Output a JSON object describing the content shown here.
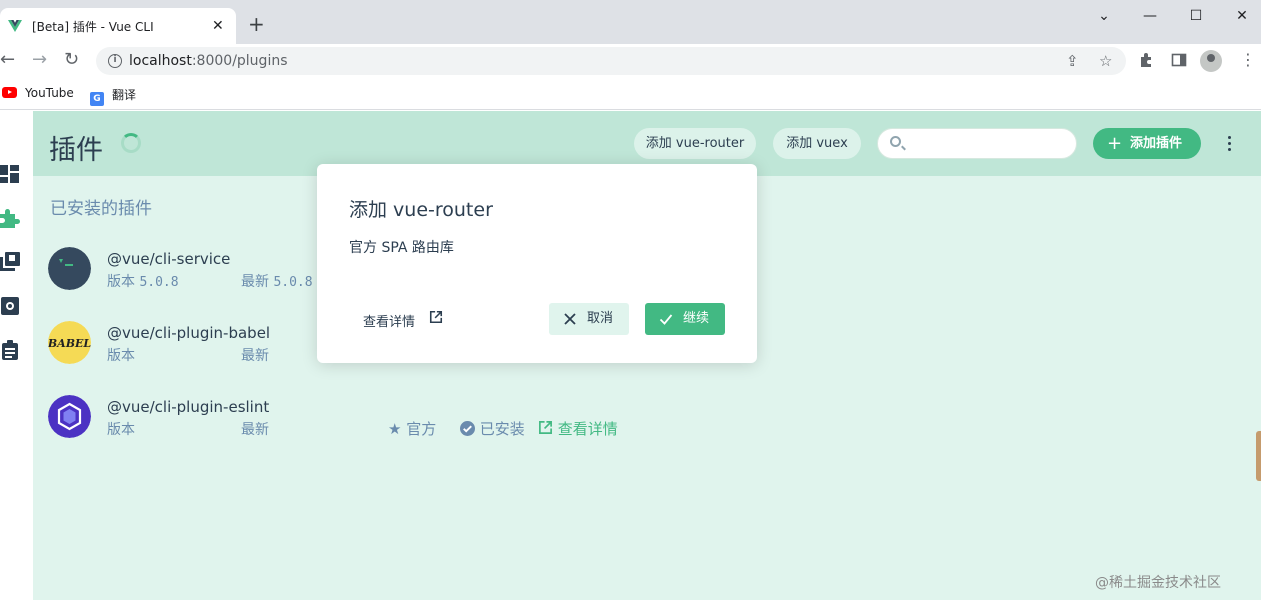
{
  "browser": {
    "tab_title": "[Beta] 插件 - Vue CLI",
    "url_host": "localhost",
    "url_path": ":8000/plugins",
    "bookmarks": [
      {
        "label": "YouTube",
        "icon": "youtube-icon"
      },
      {
        "label": "翻译",
        "icon": "google-translate-icon"
      }
    ]
  },
  "header": {
    "title": "插件",
    "quick_actions": [
      {
        "label": "添加 vue-router"
      },
      {
        "label": "添加 vuex"
      }
    ],
    "search_placeholder": "",
    "add_button": "添加插件"
  },
  "sidebar": {
    "items": [
      {
        "name": "dashboard",
        "icon": "dashboard-icon"
      },
      {
        "name": "plugins",
        "icon": "puzzle-icon",
        "active": true
      },
      {
        "name": "dependencies",
        "icon": "library-icon"
      },
      {
        "name": "configuration",
        "icon": "settings-icon"
      },
      {
        "name": "tasks",
        "icon": "clipboard-icon"
      }
    ]
  },
  "main": {
    "section_title": "已安装的插件",
    "plugins": [
      {
        "name": "@vue/cli-service",
        "version_label": "版本",
        "version": "5.0.8",
        "latest_label": "最新",
        "latest": "5.0.8"
      },
      {
        "name": "@vue/cli-plugin-babel",
        "version_label": "版本",
        "latest_label": "最新"
      },
      {
        "name": "@vue/cli-plugin-eslint",
        "version_label": "版本",
        "latest_label": "最新",
        "official": "官方",
        "installed": "已安装",
        "details": "查看详情"
      }
    ]
  },
  "modal": {
    "title": "添加 vue-router",
    "description": "官方 SPA 路由库",
    "more_info": "查看详情",
    "cancel": "取消",
    "continue": "继续"
  },
  "watermark": "@稀土掘金技术社区",
  "colors": {
    "accent": "#42b983",
    "header_bg": "#bfe6d7",
    "page_bg": "#e0f4ed",
    "muted_text": "#6a8bad"
  }
}
